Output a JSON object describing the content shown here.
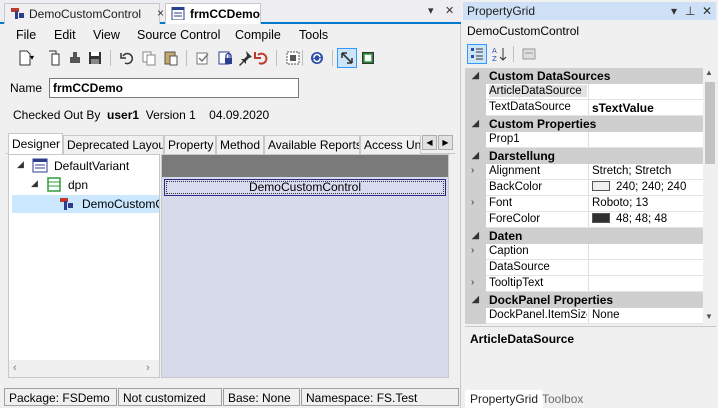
{
  "document_tabs": [
    {
      "label": "DemoCustomControl",
      "active": false
    },
    {
      "label": "frmCCDemo",
      "active": true
    }
  ],
  "window_buttons": {
    "dropdown": "▾",
    "close": "✕"
  },
  "menu": [
    "File",
    "Edit",
    "View",
    "Source Control",
    "Compile",
    "Tools"
  ],
  "form": {
    "name_label": "Name",
    "name_value": "frmCCDemo",
    "checked_out_by_label": "Checked Out By",
    "checked_out_user": "user1",
    "version_label": "Version 1",
    "date": "04.09.2020"
  },
  "inner_tabs": [
    "Designer",
    "Deprecated Layout",
    "Property",
    "Method",
    "Available Reports",
    "Access Unit"
  ],
  "tree": [
    {
      "label": "DefaultVariant",
      "level": 0,
      "expanded": true,
      "icon": "form-icon"
    },
    {
      "label": "dpn",
      "level": 1,
      "expanded": true,
      "icon": "panel-icon"
    },
    {
      "label": "DemoCustomControl",
      "level": 2,
      "selected": true,
      "icon": "custom-control-icon"
    }
  ],
  "canvas": {
    "control_label": "DemoCustomControl"
  },
  "status": [
    "Package: FSDemo",
    "Not customized",
    "Base: None",
    "Namespace: FS.Test"
  ],
  "property_grid": {
    "title": "PropertyGrid",
    "object": "DemoCustomControl",
    "rows": [
      {
        "type": "category",
        "name": "Custom DataSources"
      },
      {
        "type": "prop",
        "name": "ArticleDataSource",
        "value": "",
        "highlight": true
      },
      {
        "type": "prop",
        "name": "TextDataSource",
        "value": "sTextValue",
        "bold": true
      },
      {
        "type": "category",
        "name": "Custom Properties"
      },
      {
        "type": "prop",
        "name": "Prop1",
        "value": ""
      },
      {
        "type": "category",
        "name": "Darstellung"
      },
      {
        "type": "prop",
        "name": "Alignment",
        "value": "Stretch; Stretch",
        "expandable": true
      },
      {
        "type": "prop",
        "name": "BackColor",
        "value": "240; 240; 240",
        "swatch": "#f0f0f0"
      },
      {
        "type": "prop",
        "name": "Font",
        "value": "Roboto; 13",
        "expandable": true
      },
      {
        "type": "prop",
        "name": "ForeColor",
        "value": "48; 48; 48",
        "swatch": "#303030"
      },
      {
        "type": "category",
        "name": "Daten"
      },
      {
        "type": "prop",
        "name": "Caption",
        "value": "",
        "expandable": true
      },
      {
        "type": "prop",
        "name": "DataSource",
        "value": ""
      },
      {
        "type": "prop",
        "name": "TooltipText",
        "value": "",
        "expandable": true
      },
      {
        "type": "category",
        "name": "DockPanel Properties"
      },
      {
        "type": "prop",
        "name": "DockPanel.ItemSize",
        "value": "None"
      }
    ],
    "description_title": "ArticleDataSource",
    "bottom_tabs": [
      "PropertyGrid",
      "Toolbox"
    ]
  },
  "colors": {
    "accent": "#007acc",
    "selection": "#cce8ff",
    "canvas": "#d6daea",
    "category": "#cfcfcf"
  }
}
